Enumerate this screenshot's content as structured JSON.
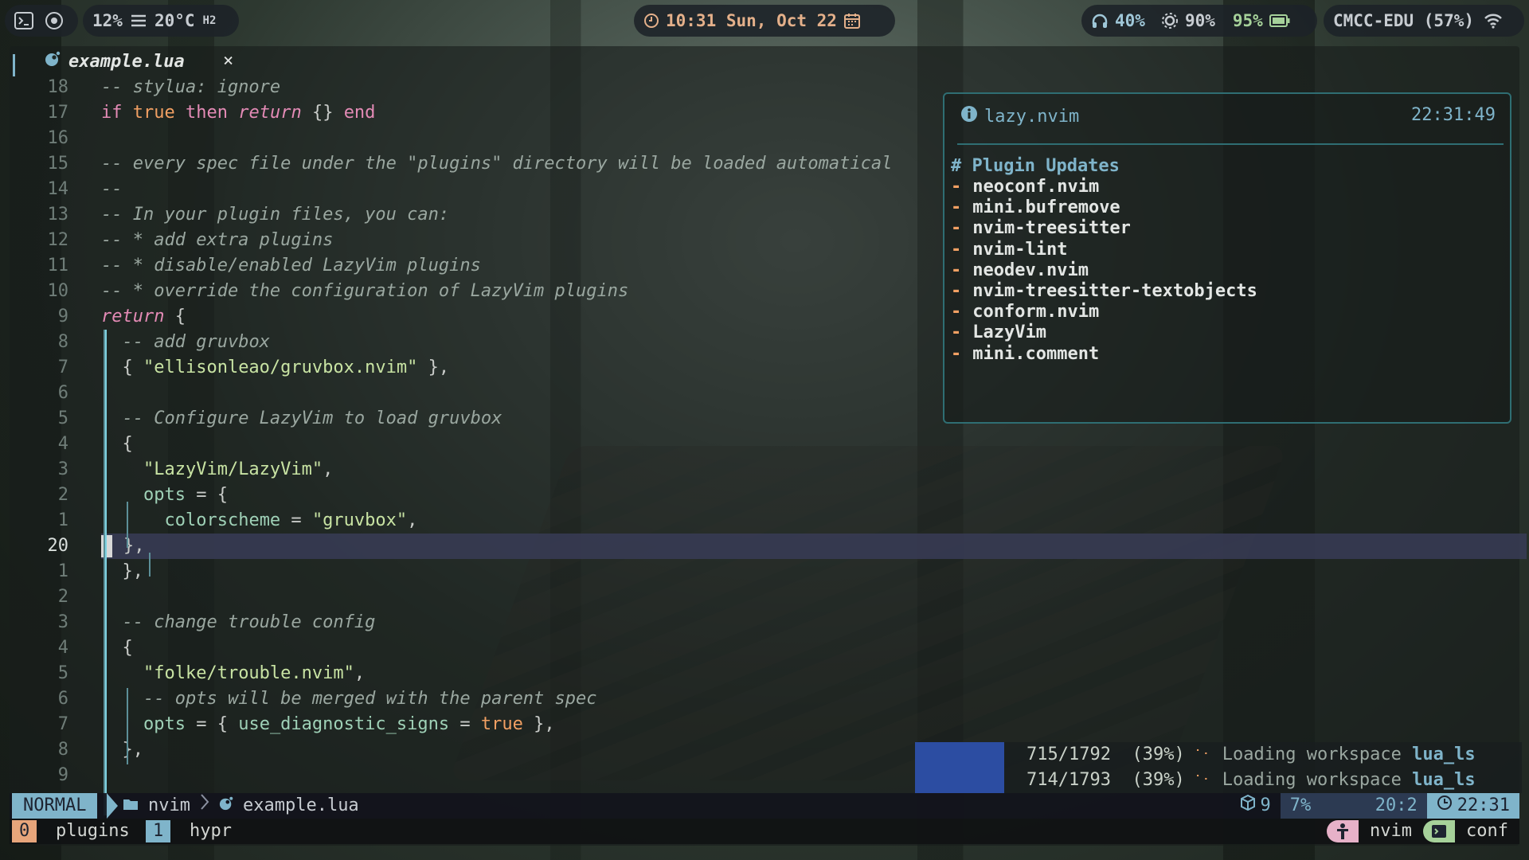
{
  "topbar": {
    "cpu": "12%",
    "temp": "20°C",
    "humidity": "H2",
    "clock": "10:31 Sun, Oct 22",
    "volume": "40%",
    "brightness": "90%",
    "battery": "95%",
    "network": "CMCC-EDU (57%)"
  },
  "tab": {
    "filename": "example.lua",
    "close": "×"
  },
  "code": [
    {
      "ln": "18",
      "parts": [
        [
          "cmt",
          "-- stylua: ignore"
        ]
      ]
    },
    {
      "ln": "17",
      "parts": [
        [
          "kw",
          "if "
        ],
        [
          "bool",
          "true"
        ],
        [
          "kw",
          " then "
        ],
        [
          "kwi",
          "return"
        ],
        [
          "pun",
          " {} "
        ],
        [
          "kw",
          "end"
        ]
      ]
    },
    {
      "ln": "16",
      "parts": []
    },
    {
      "ln": "15",
      "parts": [
        [
          "cmt",
          "-- every spec file under the \"plugins\" directory will be loaded automatical"
        ]
      ]
    },
    {
      "ln": "14",
      "parts": [
        [
          "cmt",
          "--"
        ]
      ]
    },
    {
      "ln": "13",
      "parts": [
        [
          "cmt",
          "-- In your plugin files, you can:"
        ]
      ]
    },
    {
      "ln": "12",
      "parts": [
        [
          "cmt",
          "-- * add extra plugins"
        ]
      ]
    },
    {
      "ln": "11",
      "parts": [
        [
          "cmt",
          "-- * disable/enabled LazyVim plugins"
        ]
      ]
    },
    {
      "ln": "10",
      "parts": [
        [
          "cmt",
          "-- * override the configuration of LazyVim plugins"
        ]
      ]
    },
    {
      "ln": "9",
      "parts": [
        [
          "kwi",
          "return"
        ],
        [
          "pun",
          " {"
        ]
      ]
    },
    {
      "ln": "8",
      "parts": [
        [
          "pun",
          "  "
        ],
        [
          "cmt",
          "-- add gruvbox"
        ]
      ]
    },
    {
      "ln": "7",
      "parts": [
        [
          "pun",
          "  { "
        ],
        [
          "str",
          "\"ellisonleao/gruvbox.nvim\""
        ],
        [
          "pun",
          " },"
        ]
      ]
    },
    {
      "ln": "6",
      "parts": []
    },
    {
      "ln": "5",
      "parts": [
        [
          "pun",
          "  "
        ],
        [
          "cmt",
          "-- Configure LazyVim to load gruvbox"
        ]
      ]
    },
    {
      "ln": "4",
      "parts": [
        [
          "pun",
          "  {"
        ]
      ]
    },
    {
      "ln": "3",
      "parts": [
        [
          "pun",
          "    "
        ],
        [
          "str",
          "\"LazyVim/LazyVim\""
        ],
        [
          "pun",
          ","
        ]
      ]
    },
    {
      "ln": "2",
      "parts": [
        [
          "pun",
          "    "
        ],
        [
          "id",
          "opts"
        ],
        [
          "pun",
          " = {"
        ]
      ]
    },
    {
      "ln": "1",
      "parts": [
        [
          "pun",
          "      "
        ],
        [
          "id",
          "colorscheme"
        ],
        [
          "pun",
          " = "
        ],
        [
          "str",
          "\"gruvbox\""
        ],
        [
          "pun",
          ","
        ]
      ]
    },
    {
      "ln": "20",
      "cur": true,
      "parts": [
        [
          "pun",
          "    },"
        ]
      ]
    },
    {
      "ln": "1",
      "parts": [
        [
          "pun",
          "  },"
        ]
      ]
    },
    {
      "ln": "2",
      "parts": []
    },
    {
      "ln": "3",
      "parts": [
        [
          "pun",
          "  "
        ],
        [
          "cmt",
          "-- change trouble config"
        ]
      ]
    },
    {
      "ln": "4",
      "parts": [
        [
          "pun",
          "  {"
        ]
      ]
    },
    {
      "ln": "5",
      "parts": [
        [
          "pun",
          "    "
        ],
        [
          "str",
          "\"folke/trouble.nvim\""
        ],
        [
          "pun",
          ","
        ]
      ]
    },
    {
      "ln": "6",
      "parts": [
        [
          "pun",
          "    "
        ],
        [
          "cmt",
          "-- opts will be merged with the parent spec"
        ]
      ]
    },
    {
      "ln": "7",
      "parts": [
        [
          "pun",
          "    "
        ],
        [
          "id",
          "opts"
        ],
        [
          "pun",
          " = { "
        ],
        [
          "id",
          "use_diagnostic_signs"
        ],
        [
          "pun",
          " = "
        ],
        [
          "bool",
          "true"
        ],
        [
          "pun",
          " },"
        ]
      ]
    },
    {
      "ln": "8",
      "parts": [
        [
          "pun",
          "  },"
        ]
      ]
    },
    {
      "ln": "9",
      "parts": []
    }
  ],
  "notification": {
    "source": "lazy.nvim",
    "time": "22:31:49",
    "title": "# Plugin Updates",
    "items": [
      "neoconf.nvim",
      "mini.bufremove",
      "nvim-treesitter",
      "nvim-lint",
      "neodev.nvim",
      "nvim-treesitter-textobjects",
      "conform.nvim",
      "LazyVim",
      "mini.comment"
    ]
  },
  "progress": [
    {
      "count": "715/1792",
      "pct": "(39%)",
      "msg": "Loading workspace",
      "server": "lua_ls"
    },
    {
      "count": "714/1793",
      "pct": "(39%)",
      "msg": "Loading workspace",
      "server": "lua_ls"
    }
  ],
  "statusline": {
    "mode": "NORMAL",
    "dir": "nvim",
    "file": "example.lua",
    "plugins": "9",
    "percent": "7%",
    "position": "20:2",
    "clock": "22:31"
  },
  "tmux": {
    "windows": [
      {
        "index": "0",
        "name": "plugins"
      },
      {
        "index": "1",
        "name": "hypr"
      }
    ],
    "session": "nvim",
    "host": "conf"
  },
  "colors": {
    "accent": "#7fb4ca",
    "orange": "#f2a063",
    "string": "#c8e3a3",
    "keyword": "#e48bb6",
    "progress": "#2c4da2"
  }
}
